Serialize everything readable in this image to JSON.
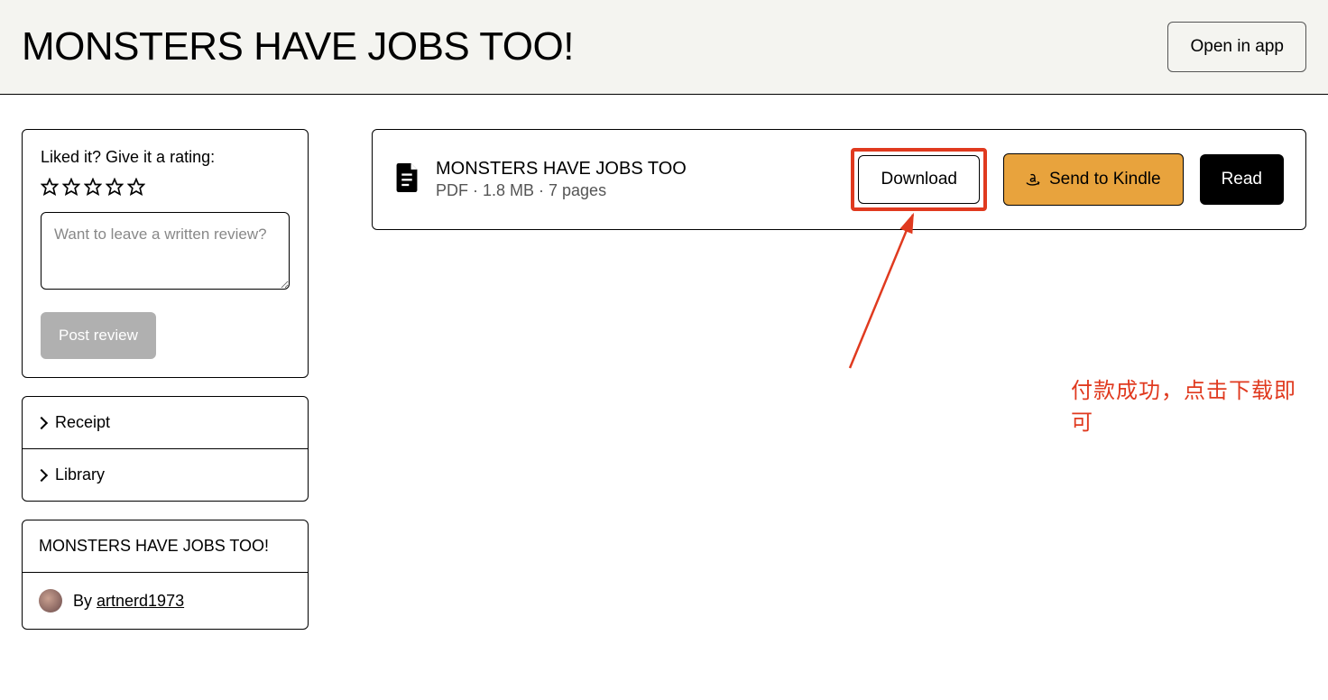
{
  "header": {
    "title": "MONSTERS HAVE JOBS TOO!",
    "open_app": "Open in app"
  },
  "rating": {
    "prompt": "Liked it? Give it a rating:",
    "placeholder": "Want to leave a written review?",
    "post_label": "Post review"
  },
  "collapse": {
    "receipt": "Receipt",
    "library": "Library"
  },
  "product": {
    "title": "MONSTERS HAVE JOBS TOO!",
    "by_prefix": "By ",
    "author": "artnerd1973"
  },
  "file": {
    "title": "MONSTERS HAVE JOBS TOO",
    "meta": "PDF · 1.8 MB · 7 pages",
    "download": "Download",
    "kindle": "Send to Kindle",
    "read": "Read"
  },
  "annotation": {
    "text": "付款成功，点击下载即可"
  }
}
